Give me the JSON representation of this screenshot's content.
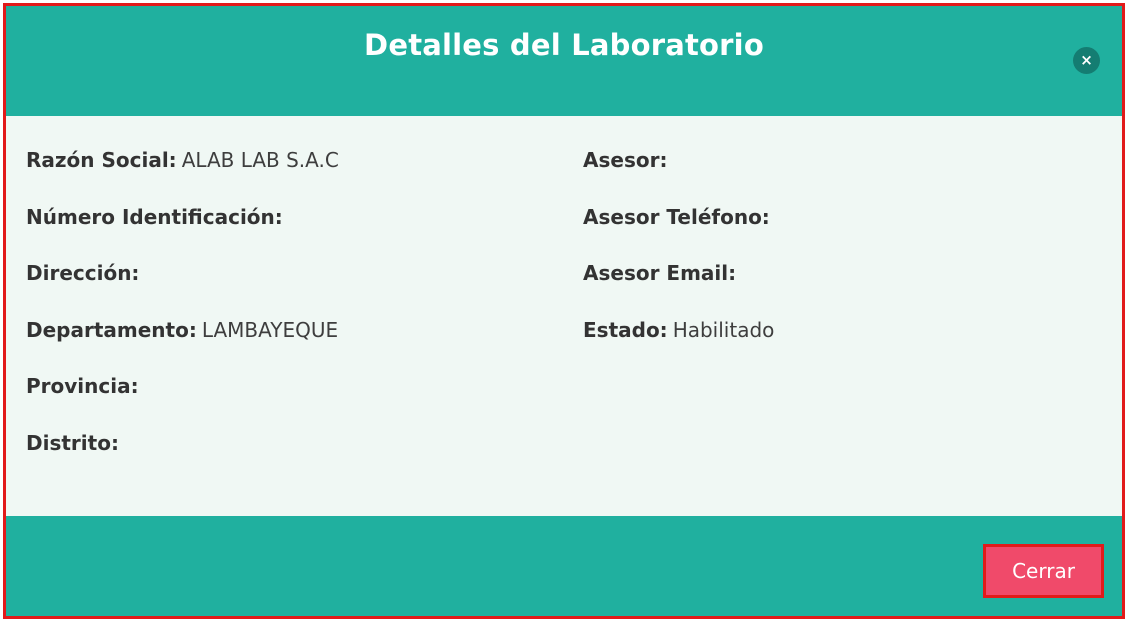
{
  "modal": {
    "title": "Detalles del Laboratorio",
    "close_icon": "×",
    "close_button_label": "Cerrar"
  },
  "fields_left": [
    {
      "label": "Razón Social:",
      "value": "ALAB LAB S.A.C"
    },
    {
      "label": "Número Identificación:",
      "value": ""
    },
    {
      "label": "Dirección:",
      "value": ""
    },
    {
      "label": "Departamento:",
      "value": "LAMBAYEQUE"
    },
    {
      "label": "Provincia:",
      "value": ""
    },
    {
      "label": "Distrito:",
      "value": ""
    }
  ],
  "fields_right": [
    {
      "label": "Asesor:",
      "value": ""
    },
    {
      "label": "Asesor Teléfono:",
      "value": ""
    },
    {
      "label": "Asesor Email:",
      "value": ""
    },
    {
      "label": "Estado:",
      "value": "Habilitado"
    }
  ],
  "colors": {
    "header_bg": "#20b09f",
    "body_bg": "#f0f8f4",
    "close_button_bg": "#f04a6a",
    "highlight_border": "#e21a1a"
  }
}
